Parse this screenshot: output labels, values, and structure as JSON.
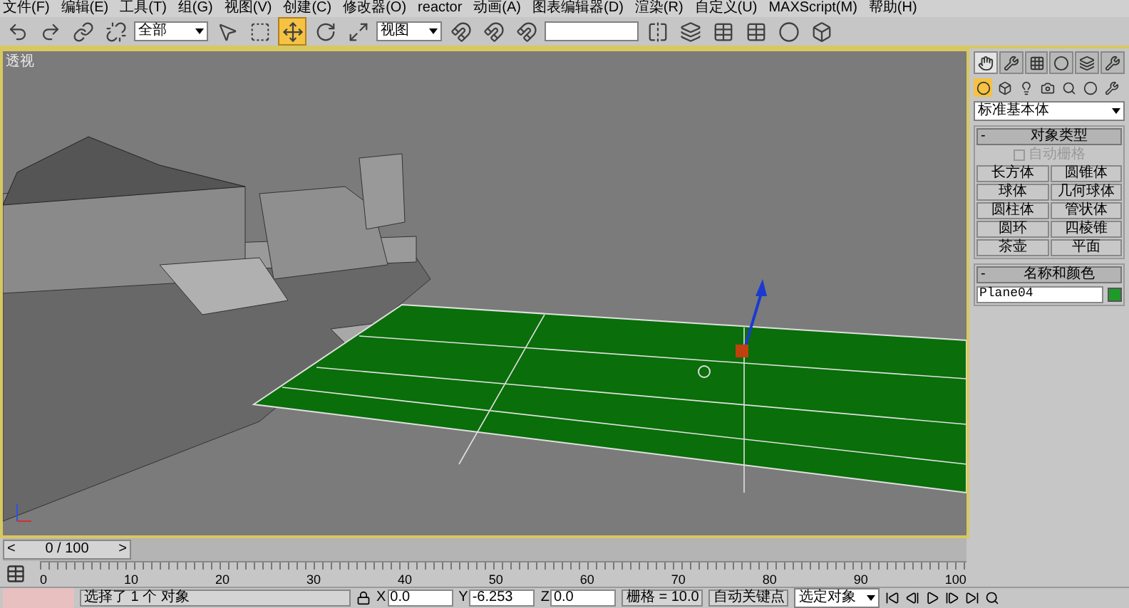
{
  "menu": [
    "文件(F)",
    "编辑(E)",
    "工具(T)",
    "组(G)",
    "视图(V)",
    "创建(C)",
    "修改器(O)",
    "reactor",
    "动画(A)",
    "图表编辑器(D)",
    "渲染(R)",
    "自定义(U)",
    "MAXScript(M)",
    "帮助(H)"
  ],
  "toolbar": {
    "selection_filter": "全部",
    "coordinate_system": "视图",
    "transform_tools": [
      {
        "selected": true
      },
      {
        "selected": false
      },
      {
        "selected": false
      }
    ]
  },
  "viewport": {
    "label": "透视"
  },
  "command_panel": {
    "tabs": [
      {
        "selected": true
      },
      {
        "selected": false
      },
      {
        "selected": false
      },
      {
        "selected": false
      },
      {
        "selected": false
      },
      {
        "selected": false
      }
    ],
    "categories": [
      {
        "selected": true
      },
      {
        "selected": false
      },
      {
        "selected": false
      },
      {
        "selected": false
      },
      {
        "selected": false
      },
      {
        "selected": false
      },
      {
        "selected": false
      }
    ],
    "subtype": "标准基本体",
    "object_type": {
      "toggle": "-",
      "title": "对象类型",
      "autogrid": {
        "label": "自动栅格",
        "checked": false,
        "disabled": true
      },
      "buttons": [
        "长方体",
        "圆锥体",
        "球体",
        "几何球体",
        "圆柱体",
        "管状体",
        "圆环",
        "四棱锥",
        "茶壶",
        "平面"
      ]
    },
    "name_and_color": {
      "toggle": "-",
      "title": "名称和颜色",
      "name": "Plane04"
    }
  },
  "time_slider": {
    "prev": "<",
    "frame": "0 / 100",
    "next": ">",
    "level": 0
  },
  "ruler": {
    "ticks": [
      "0",
      "10",
      "20",
      "30",
      "40",
      "50",
      "60",
      "70",
      "80",
      "90",
      "100"
    ]
  },
  "status_bar": {
    "selection": "选择了 1 个 对象",
    "coords": [
      {
        "label": "X",
        "value": "0.0"
      },
      {
        "label": "Y",
        "value": "-6.253"
      },
      {
        "label": "Z",
        "value": "0.0"
      }
    ],
    "grid": "栅格 = 10.0",
    "auto_key": "自动关键点",
    "key_filter": "选定对象"
  }
}
